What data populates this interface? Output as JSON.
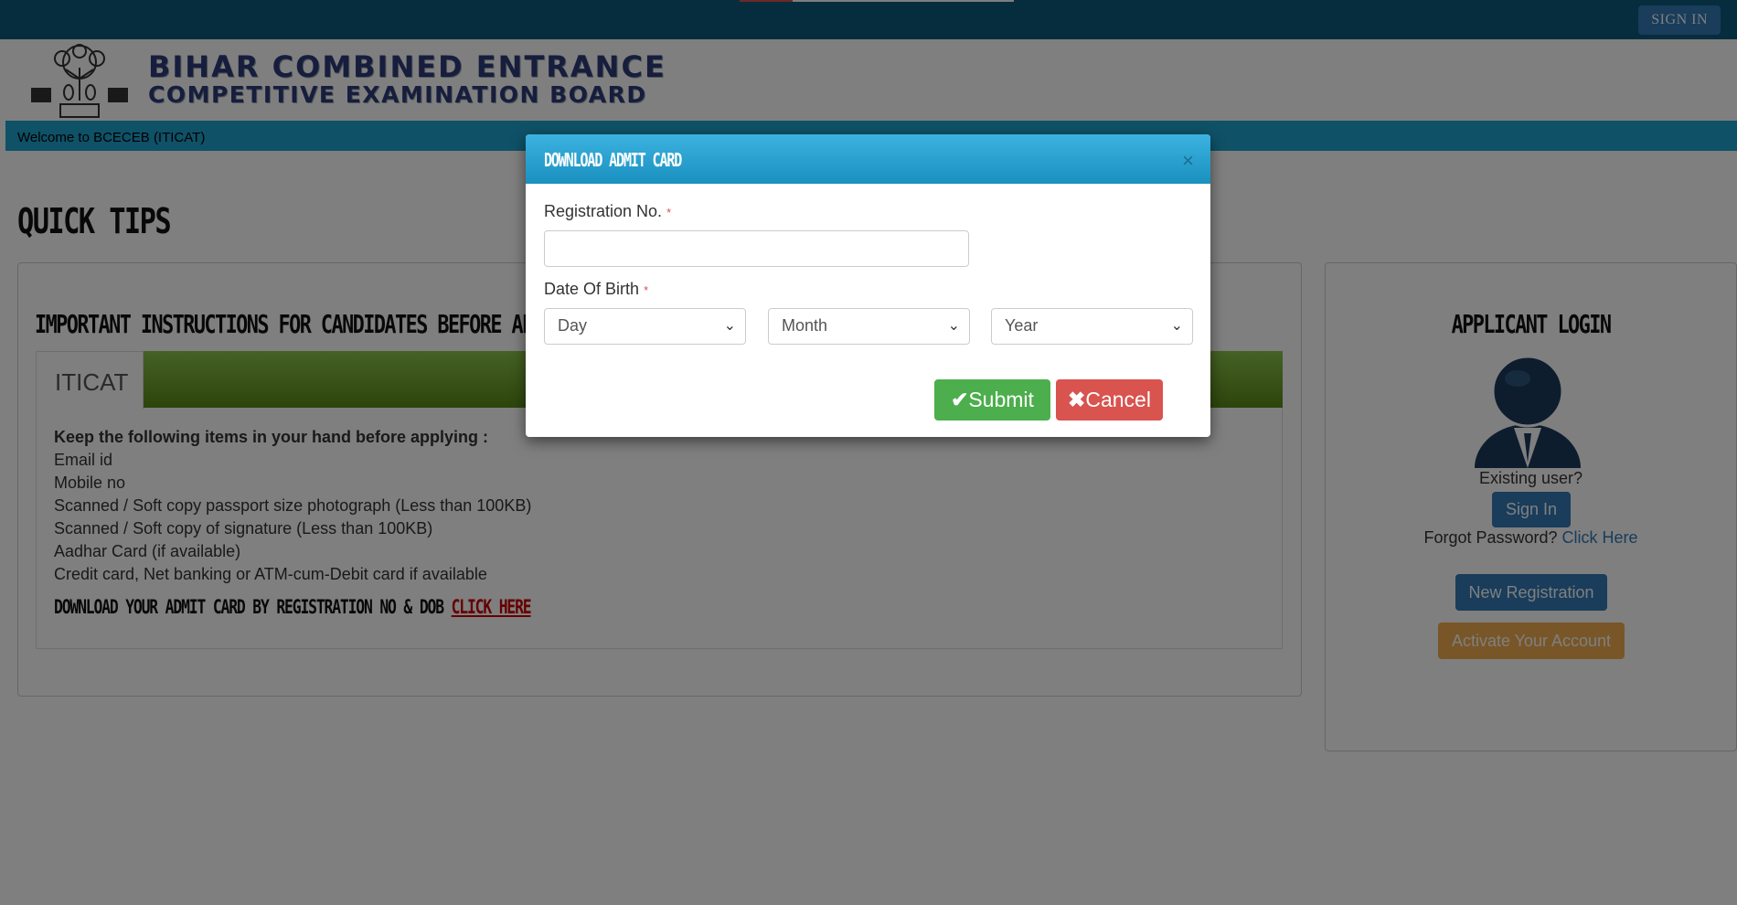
{
  "topbar": {
    "sign_in_label": "SIGN IN"
  },
  "header": {
    "org_line1": "BIHAR COMBINED ENTRANCE",
    "org_line2": "COMPETITIVE EXAMINATION BOARD"
  },
  "welcome_text": "Welcome to BCECEB (ITICAT)",
  "quick_tips_title": "QUICK TIPS",
  "instructions": {
    "title": "IMPORTANT INSTRUCTIONS FOR CANDIDATES BEFORE APPLYI",
    "tab_label": "ITICAT",
    "lead": "Keep the following items in your hand before applying :",
    "items": [
      "Email id",
      "Mobile no",
      "Scanned / Soft copy passport size photograph (Less than 100KB)",
      "Scanned / Soft copy of signature (Less than 100KB)",
      "Aadhar Card (if available)",
      "Credit card, Net banking or ATM-cum-Debit card if available"
    ],
    "download_text": "DOWNLOAD YOUR ADMIT CARD BY REGISTRATION NO & DOB ",
    "download_link": "CLICK HERE"
  },
  "login": {
    "title": "APPLICANT LOGIN",
    "existing_user": "Existing user?",
    "sign_in_label": "Sign In",
    "forgot_label": "Forgot Password? ",
    "forgot_link": "Click Here",
    "new_registration_label": "New Registration",
    "activate_label": "Activate Your Account"
  },
  "modal": {
    "title": "DOWNLOAD ADMIT CARD",
    "close_glyph": "×",
    "reg_label": "Registration No.",
    "reg_value": "",
    "dob_label": "Date Of Birth",
    "required_mark": "*",
    "day_selected": "Day",
    "month_selected": "Month",
    "year_selected": "Year",
    "submit_label": "Submit",
    "cancel_label": "Cancel"
  },
  "icons": {
    "chevron": "chevron-down-icon",
    "check": "check-icon",
    "cross": "cross-icon"
  },
  "colors": {
    "topbar": "#0c5a7a",
    "welcome_bar": "#1fa2cf",
    "primary": "#337ab7",
    "success": "#4cae4c",
    "danger": "#d9534f",
    "warning": "#f0ad4e",
    "tab_green": "#6fa82a"
  }
}
